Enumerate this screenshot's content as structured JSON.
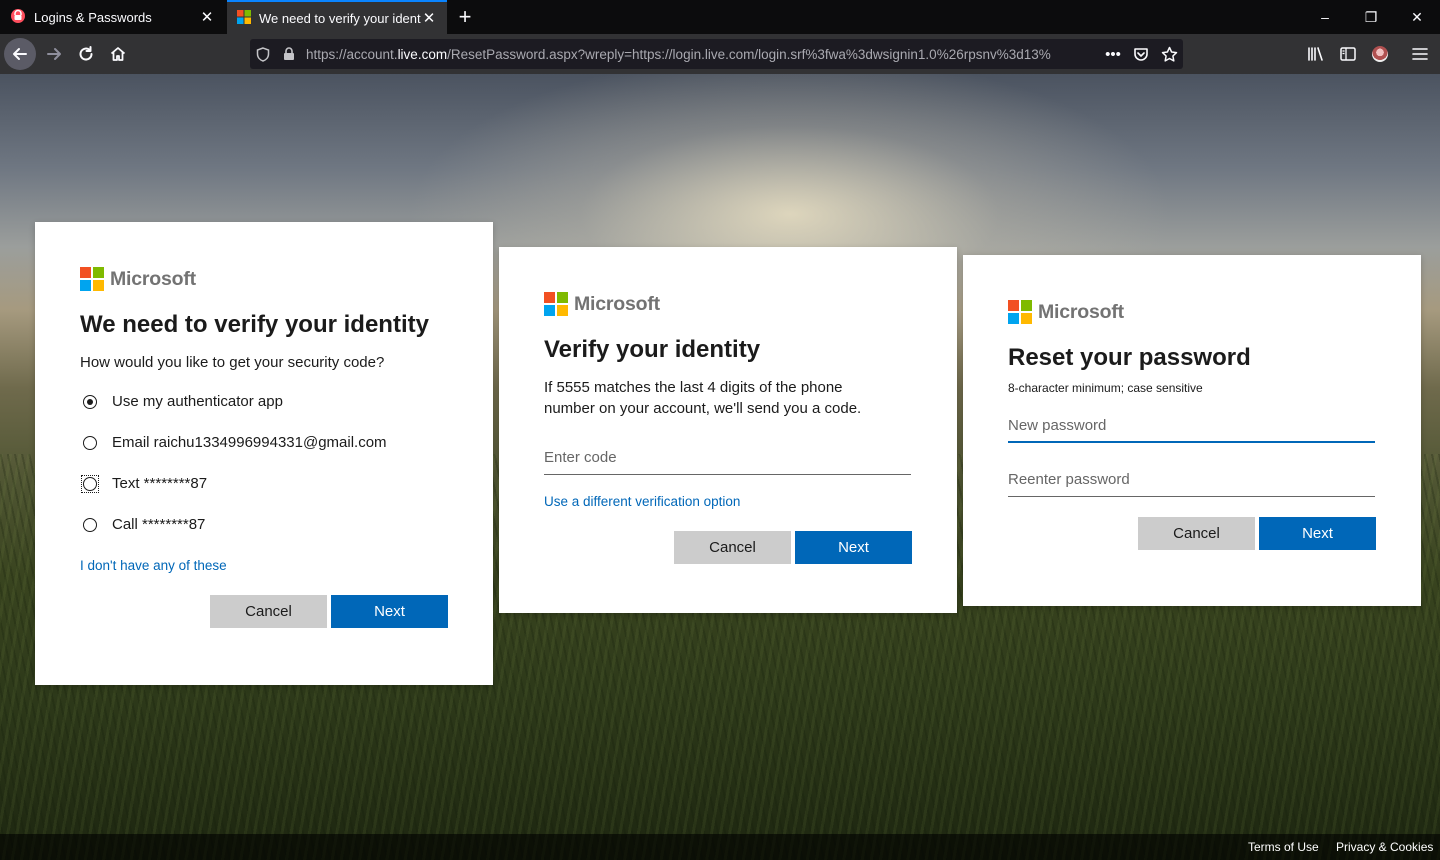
{
  "browser": {
    "tabs": [
      {
        "title": "Logins & Passwords",
        "active": false
      },
      {
        "title": "We need to verify your identity",
        "active": true
      }
    ],
    "url_prefix": "https://account.",
    "url_host": "live.com",
    "url_rest": "/ResetPassword.aspx?wreply=https://login.live.com/login.srf%3fwa%3dwsignin1.0%26rpsnv%3d13%",
    "window_controls": {
      "minimize": "–",
      "restore": "❐",
      "close": "✕"
    }
  },
  "brand": {
    "name": "Microsoft",
    "colors": [
      "#f25022",
      "#7fba00",
      "#00a4ef",
      "#ffb900"
    ],
    "accent": "#0067b8"
  },
  "card1": {
    "title": "We need to verify your identity",
    "subtitle": "How would you like to get your security code?",
    "options": [
      {
        "label": "Use my authenticator app",
        "checked": true
      },
      {
        "label": "Email raichu1334996994331@gmail.com",
        "checked": false
      },
      {
        "label": "Text ********87",
        "checked": false,
        "focused": true
      },
      {
        "label": "Call ********87",
        "checked": false
      }
    ],
    "link": "I don't have any of these",
    "cancel": "Cancel",
    "next": "Next"
  },
  "card2": {
    "title": "Verify your identity",
    "description": "If 5555 matches the last 4 digits of the phone number on your account, we'll send you a code.",
    "code_placeholder": "Enter code",
    "link": "Use a different verification option",
    "cancel": "Cancel",
    "next": "Next"
  },
  "card3": {
    "title": "Reset your password",
    "hint": "8-character minimum; case sensitive",
    "new_password_placeholder": "New password",
    "reenter_password_placeholder": "Reenter password",
    "cancel": "Cancel",
    "next": "Next"
  },
  "footer": {
    "terms": "Terms of Use",
    "privacy": "Privacy & Cookies"
  }
}
